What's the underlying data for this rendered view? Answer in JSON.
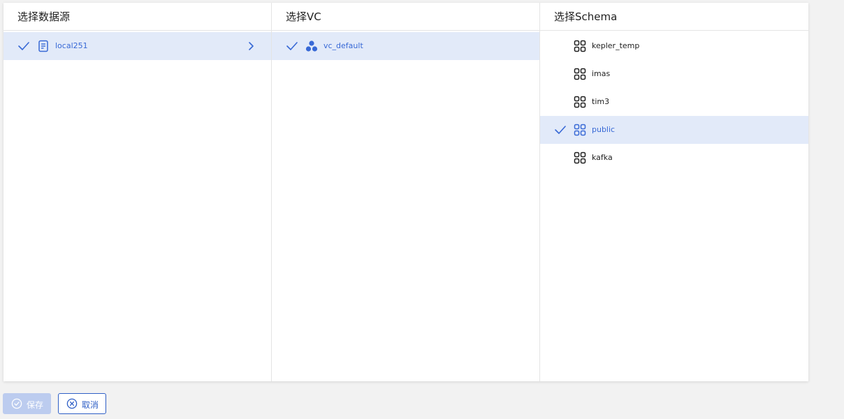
{
  "colors": {
    "accent": "#3869d6",
    "selected_row_bg": "#e2eaf9",
    "save_disabled_bg": "#bcccef"
  },
  "datasource": {
    "title": "选择数据源",
    "items": [
      {
        "label": "local251",
        "selected": true,
        "icon": "document-icon"
      }
    ]
  },
  "vc": {
    "title": "选择VC",
    "items": [
      {
        "label": "vc_default",
        "selected": true,
        "icon": "cluster-icon"
      }
    ]
  },
  "schema": {
    "title": "选择Schema",
    "items": [
      {
        "label": "kepler_temp",
        "selected": false,
        "icon": "grid-icon"
      },
      {
        "label": "imas",
        "selected": false,
        "icon": "grid-icon"
      },
      {
        "label": "tim3",
        "selected": false,
        "icon": "grid-icon"
      },
      {
        "label": "public",
        "selected": true,
        "icon": "grid-icon"
      },
      {
        "label": "kafka",
        "selected": false,
        "icon": "grid-icon"
      }
    ]
  },
  "actions": {
    "save_label": "保存",
    "cancel_label": "取消"
  }
}
